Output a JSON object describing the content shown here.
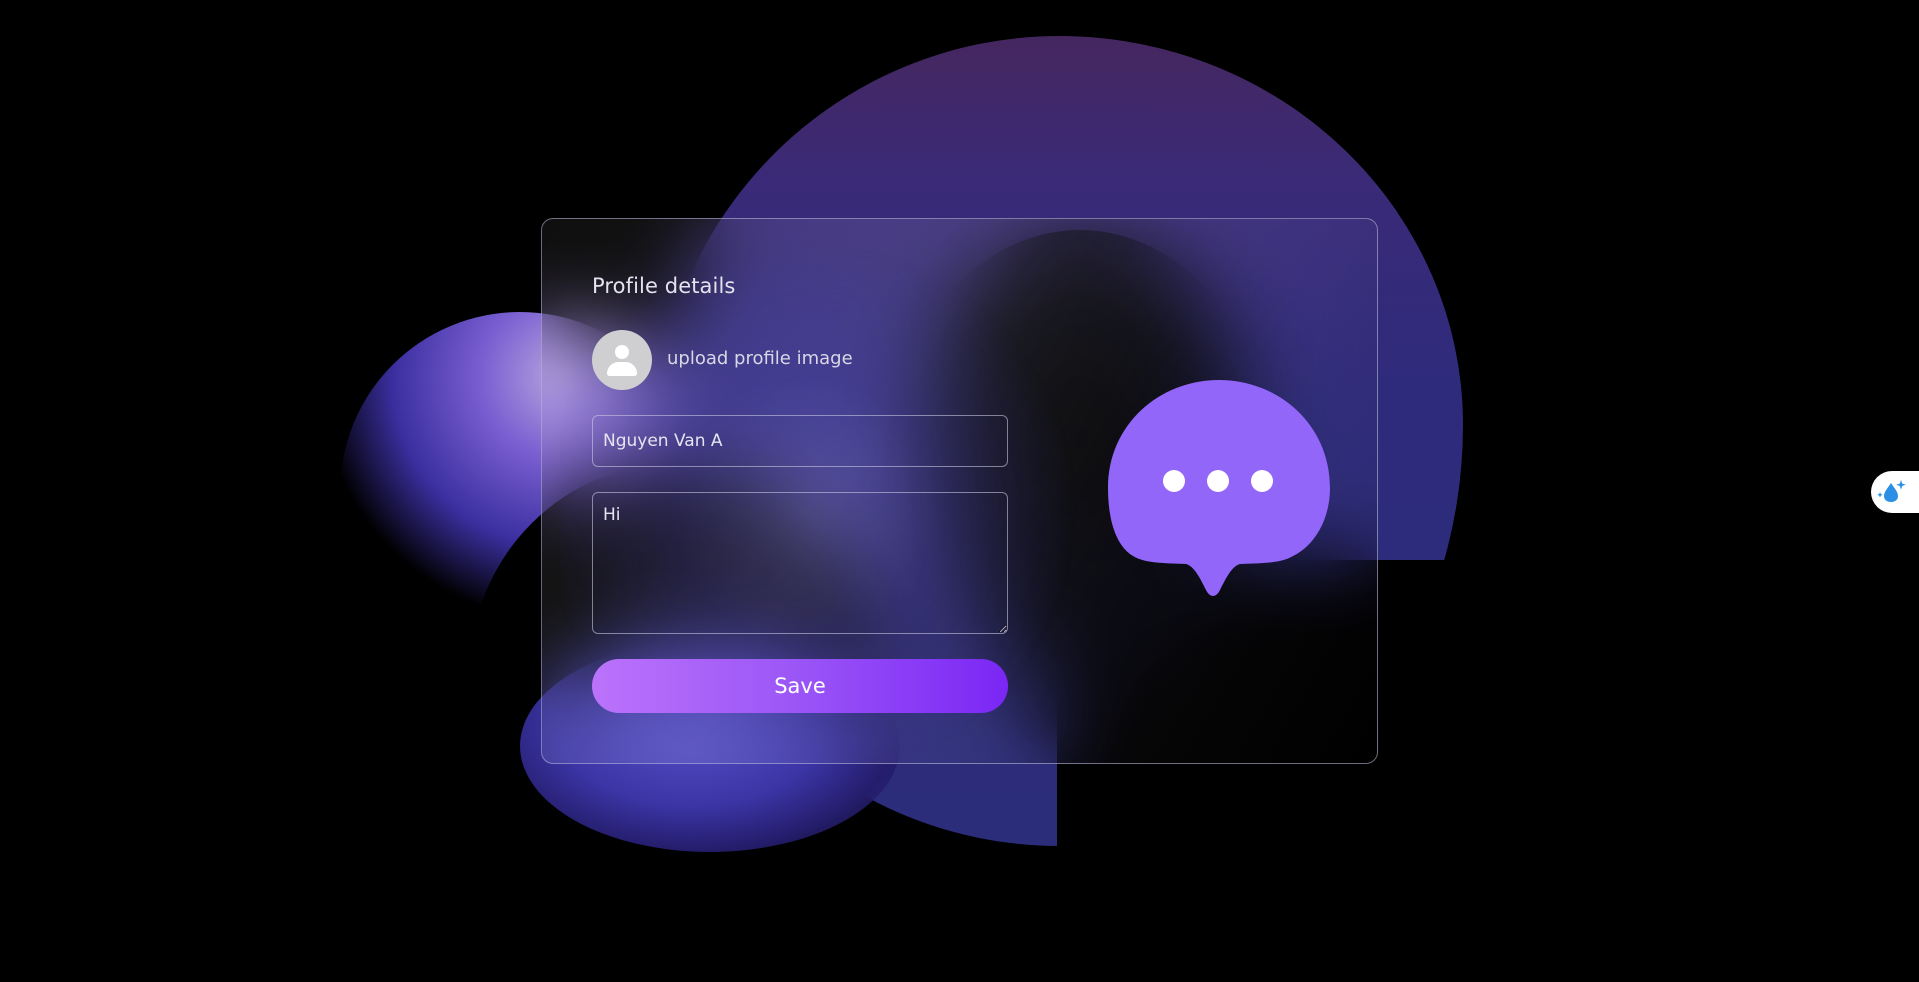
{
  "form": {
    "title": "Profile details",
    "upload_label": "upload profile image",
    "name_value": "Nguyen Van A",
    "bio_value": "Hi",
    "save_label": "Save"
  },
  "icons": {
    "avatar": "user-avatar-icon",
    "illustration": "chat-bubble-icon",
    "side_widget": "water-drop-sparkle-icon"
  },
  "colors": {
    "background": "#000000",
    "accent": "#9a55f6",
    "button_start": "#bb73fb",
    "button_end": "#7b26f5",
    "bubble": "#9166f8",
    "widget_icon": "#2b8fe6"
  }
}
